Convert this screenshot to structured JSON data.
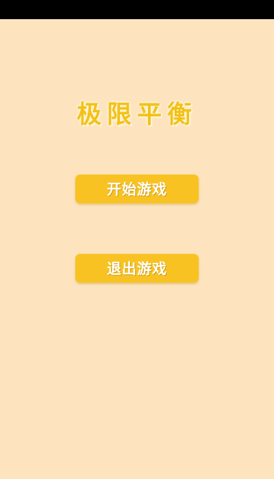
{
  "app": {
    "title": "极限平衡"
  },
  "menu": {
    "start_label": "开始游戏",
    "exit_label": "退出游戏"
  },
  "colors": {
    "background": "#fde4be",
    "title": "#f2c21a",
    "button": "#f8c322",
    "button_text": "#ffffff",
    "status_bar": "#000000"
  }
}
